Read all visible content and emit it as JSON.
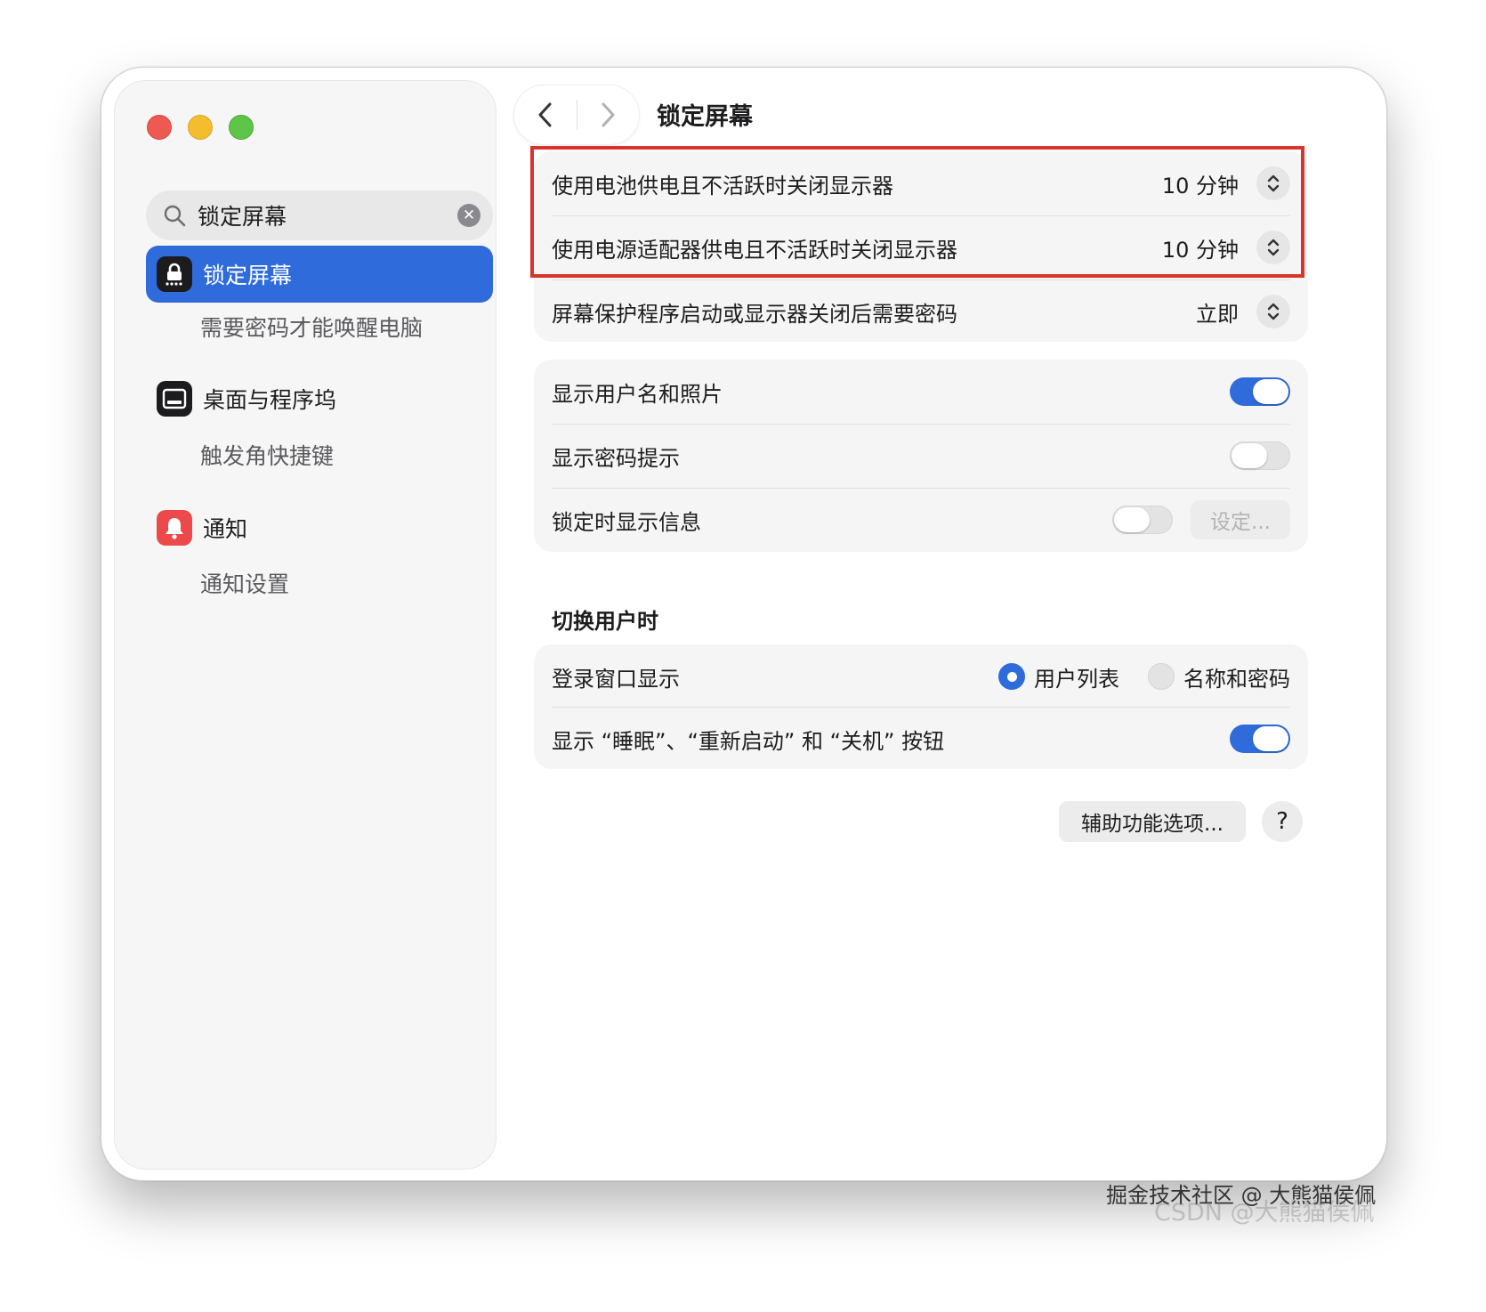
{
  "page": {
    "title": "锁定屏幕"
  },
  "sidebar": {
    "search_value": "锁定屏幕",
    "items": [
      {
        "label": "锁定屏幕",
        "sub": "需要密码才能唤醒电脑"
      },
      {
        "label": "桌面与程序坞",
        "sub": "触发角快捷键"
      },
      {
        "label": "通知",
        "sub": "通知设置"
      }
    ]
  },
  "display_group": {
    "rows": [
      {
        "label": "使用电池供电且不活跃时关闭显示器",
        "value": "10 分钟"
      },
      {
        "label": "使用电源适配器供电且不活跃时关闭显示器",
        "value": "10 分钟"
      },
      {
        "label": "屏幕保护程序启动或显示器关闭后需要密码",
        "value": "立即"
      }
    ]
  },
  "info_group": {
    "rows": [
      {
        "label": "显示用户名和照片",
        "toggle_on": true
      },
      {
        "label": "显示密码提示",
        "toggle_on": false
      },
      {
        "label": "锁定时显示信息",
        "toggle_on": false,
        "button": "设定..."
      }
    ]
  },
  "switch_users": {
    "section_title": "切换用户时",
    "login_row": {
      "label": "登录窗口显示",
      "options": [
        "用户列表",
        "名称和密码"
      ],
      "selected": "用户列表"
    },
    "buttons_row": {
      "label": "显示 “睡眠”、“重新启动” 和 “关机” 按钮",
      "toggle_on": true
    }
  },
  "footer": {
    "accessibility_button": "辅助功能选项...",
    "help_button": "?"
  },
  "watermark": {
    "line1": "掘金技术社区 @ 大熊猫侯佩",
    "line2": "CSDN @大熊猫侯佩"
  },
  "colors": {
    "accent": "#2f6bda",
    "highlight_border": "#d9332b"
  }
}
